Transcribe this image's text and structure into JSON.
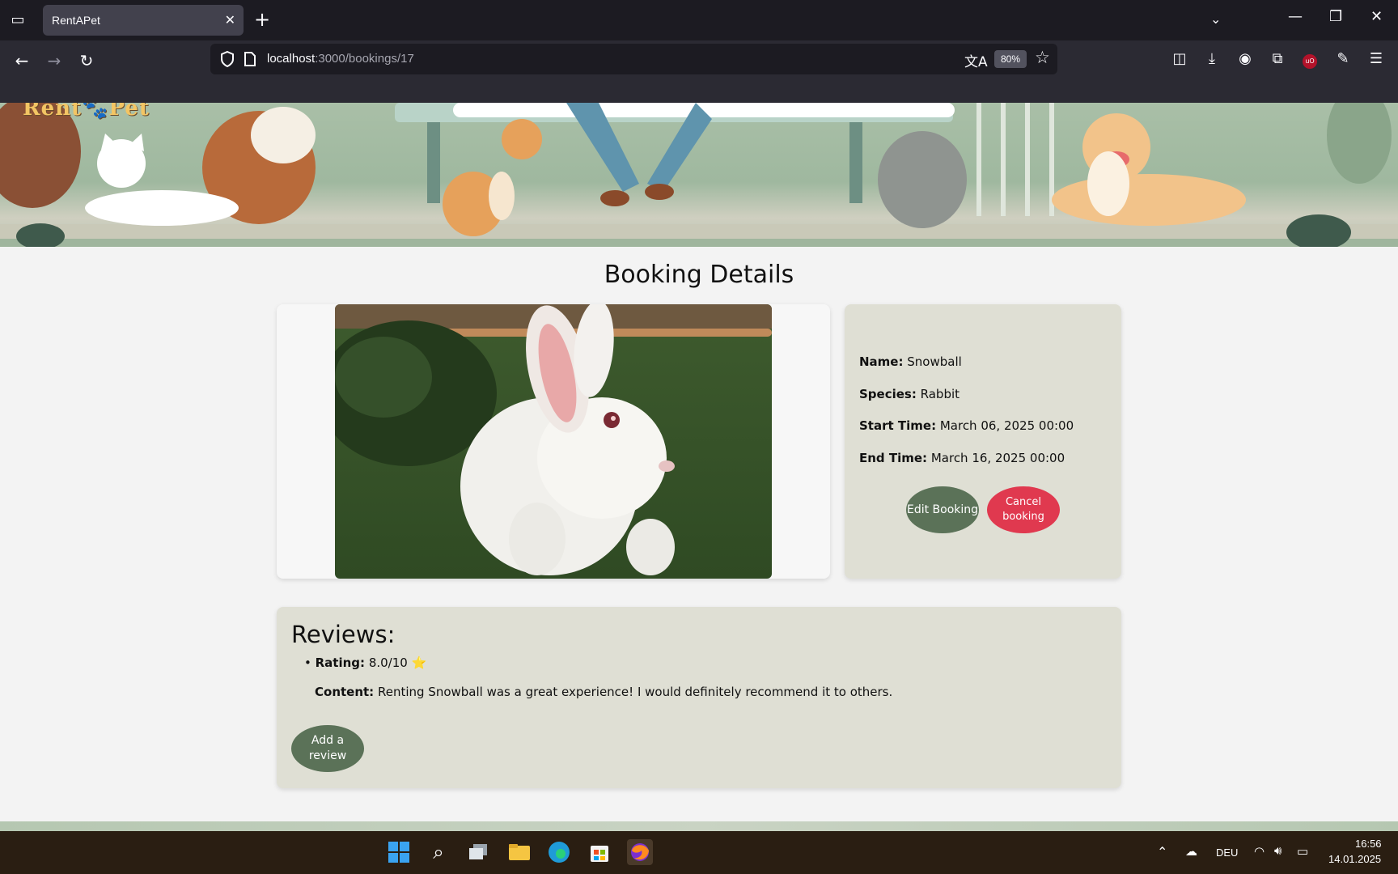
{
  "browser": {
    "tab_title": "RentAPet",
    "url_host": "localhost",
    "url_path": ":3000/bookings/17",
    "zoom": "80%"
  },
  "page": {
    "title": "Booking Details",
    "pet": {
      "name_label": "Name:",
      "name": "Snowball",
      "species_label": "Species:",
      "species": "Rabbit",
      "start_label": "Start Time:",
      "start": "March 06, 2025 00:00",
      "end_label": "End Time:",
      "end": "March 16, 2025 00:00"
    },
    "buttons": {
      "edit": "Edit Booking",
      "cancel": "Cancel booking",
      "add_review": "Add a review"
    },
    "reviews": {
      "title": "Reviews:",
      "items": [
        {
          "rating_label": "Rating:",
          "rating": "8.0/10",
          "star": "⭐",
          "content_label": "Content:",
          "content": "Renting Snowball was a great experience! I would definitely recommend it to others."
        }
      ]
    }
  },
  "taskbar": {
    "language": "DEU",
    "time": "16:56",
    "date": "14.01.2025"
  },
  "colors": {
    "primary_button": "#5b7258",
    "danger_button": "#e0394f",
    "card_bg": "#dfdfd4"
  }
}
